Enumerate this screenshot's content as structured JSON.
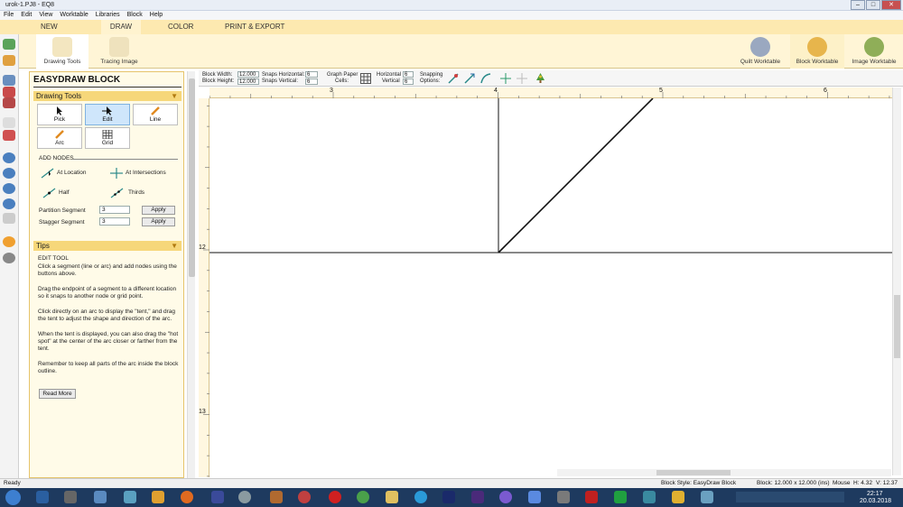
{
  "window": {
    "title": "urok-1.PJ8 - EQ8"
  },
  "menu": [
    "File",
    "Edit",
    "View",
    "Worktable",
    "Libraries",
    "Block",
    "Help"
  ],
  "ribbon_tabs": [
    "NEW BLOCK",
    "DRAW",
    "COLOR",
    "PRINT & EXPORT"
  ],
  "ribbon": {
    "drawing_tools": "Drawing Tools",
    "tracing_image": "Tracing Image",
    "quilt_worktable": "Quilt Worktable",
    "block_worktable": "Block Worktable",
    "image_worktable": "Image Worktable"
  },
  "panel": {
    "title": "EASYDRAW BLOCK",
    "drawing_tools_header": "Drawing Tools",
    "tools": [
      "Pick",
      "Edit",
      "Line",
      "Arc",
      "Grid"
    ],
    "add_nodes": "ADD NODES",
    "at_location": "At Location",
    "at_intersections": "At Intersections",
    "half": "Half",
    "thirds": "Thirds",
    "partition_label": "Partition Segment",
    "partition_value": "3",
    "stagger_label": "Stagger Segment",
    "stagger_value": "3",
    "apply": "Apply",
    "tips_header": "Tips",
    "tips_title": "EDIT TOOL",
    "tips": [
      "Click a segment (line or arc) and add nodes using the buttons above.",
      "Drag the endpoint of a segment to a different location so it snaps to another node or grid point.",
      "Click directly on an arc to display the \"tent,\" and drag the tent to adjust the shape and direction of the arc.",
      "When the tent is displayed, you can also drag the \"hot spot\" at the center of the arc closer or farther from the tent.",
      "Remember to keep all parts of the arc inside the block outline."
    ],
    "read_more": "Read More"
  },
  "options": {
    "block_width_label": "Block Width:",
    "block_width": "12.000",
    "block_height_label": "Block Height:",
    "block_height": "12.000",
    "snaps_h_label": "Snaps Horizontal:",
    "snaps_h": "6",
    "snaps_v_label": "Snaps Vertical:",
    "snaps_v": "6",
    "graph_paper_label": "Graph Paper",
    "cells_label": "Cells:",
    "horizontal_label": "Horizontal",
    "horizontal": "6",
    "vertical_label": "Vertical",
    "vertical": "6",
    "snapping_label": "Snapping",
    "options_label": "Options:"
  },
  "ruler": {
    "top": [
      "3",
      "4",
      "5",
      "6"
    ],
    "left": [
      "12",
      "13"
    ]
  },
  "status": {
    "ready": "Ready",
    "block_style": "Block Style: EasyDraw Block",
    "block_size": "Block: 12.000 x 12.000 (ins)",
    "mouse": "Mouse",
    "h": "H: 4.32",
    "v": "V: 12.37"
  },
  "taskbar": {
    "time": "22:17",
    "date": "20.03.2018"
  },
  "colors": {
    "accent": "#f6d77a",
    "ribbon": "#fff5d6",
    "taskbar": "#1e3a5f"
  }
}
